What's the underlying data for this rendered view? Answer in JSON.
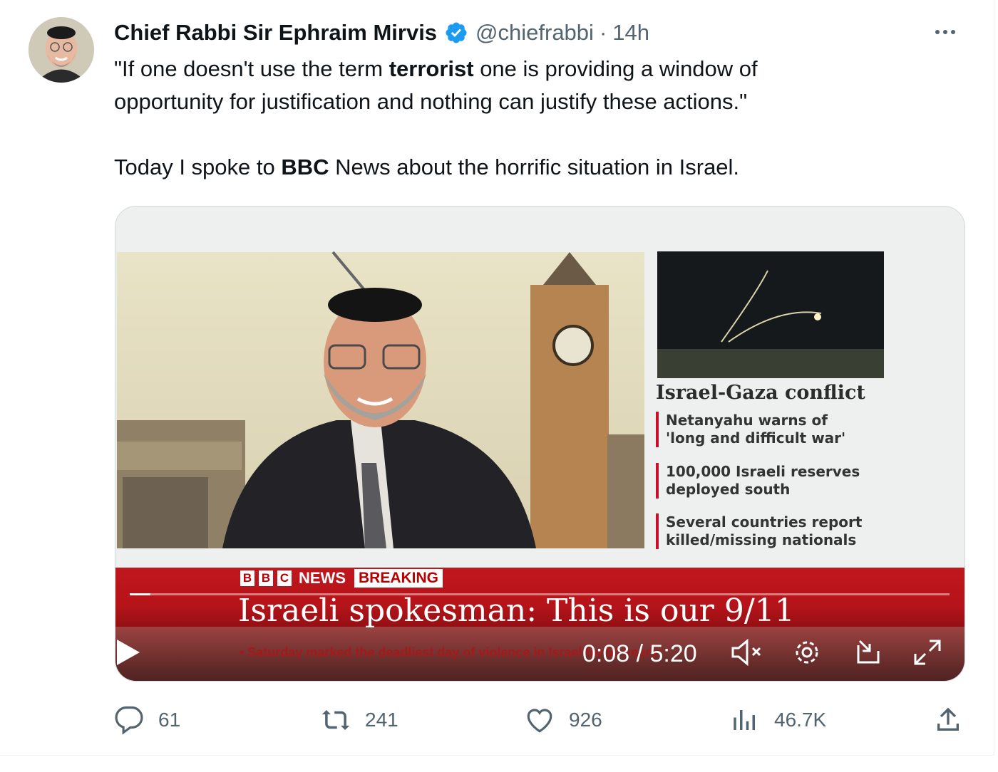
{
  "author": {
    "name": "Chief Rabbi Sir Ephraim Mirvis",
    "handle": "@chiefrabbi",
    "separator": "·",
    "time": "14h"
  },
  "tweet": {
    "line1_pre": "\"If one doesn't use the term ",
    "line1_bold": "terrorist",
    "line1_post": " one is providing a window of",
    "line2": "opportunity for justification and nothing can justify these actions.\"",
    "line3_pre": "Today I spoke to ",
    "line3_bold": "BBC",
    "line3_post": " News about the horrific situation in Israel."
  },
  "video": {
    "panel_title": "Israel-Gaza conflict",
    "bullets": [
      {
        "l1": "Netanyahu warns of",
        "l2": "'long and difficult war'"
      },
      {
        "l1": "100,000 Israeli reserves",
        "l2": "deployed south"
      },
      {
        "l1": "Several countries report",
        "l2": "killed/missing nationals"
      }
    ],
    "bbc_letters": [
      "B",
      "B",
      "C"
    ],
    "bbc_news": "NEWS",
    "breaking": "BREAKING",
    "headline": "Israeli spokesman: This is our 9/11",
    "ticker": "• Saturday marked the deadliest day of violence in Israel for 50 years",
    "timecode": "0:08 / 5:20",
    "progress_fraction": 0.025
  },
  "actions": {
    "replies": "61",
    "reposts": "241",
    "likes": "926",
    "views": "46.7K"
  },
  "colors": {
    "verified": "#1d9bf0",
    "bbc_red": "#c8102e",
    "muted": "#536471"
  }
}
